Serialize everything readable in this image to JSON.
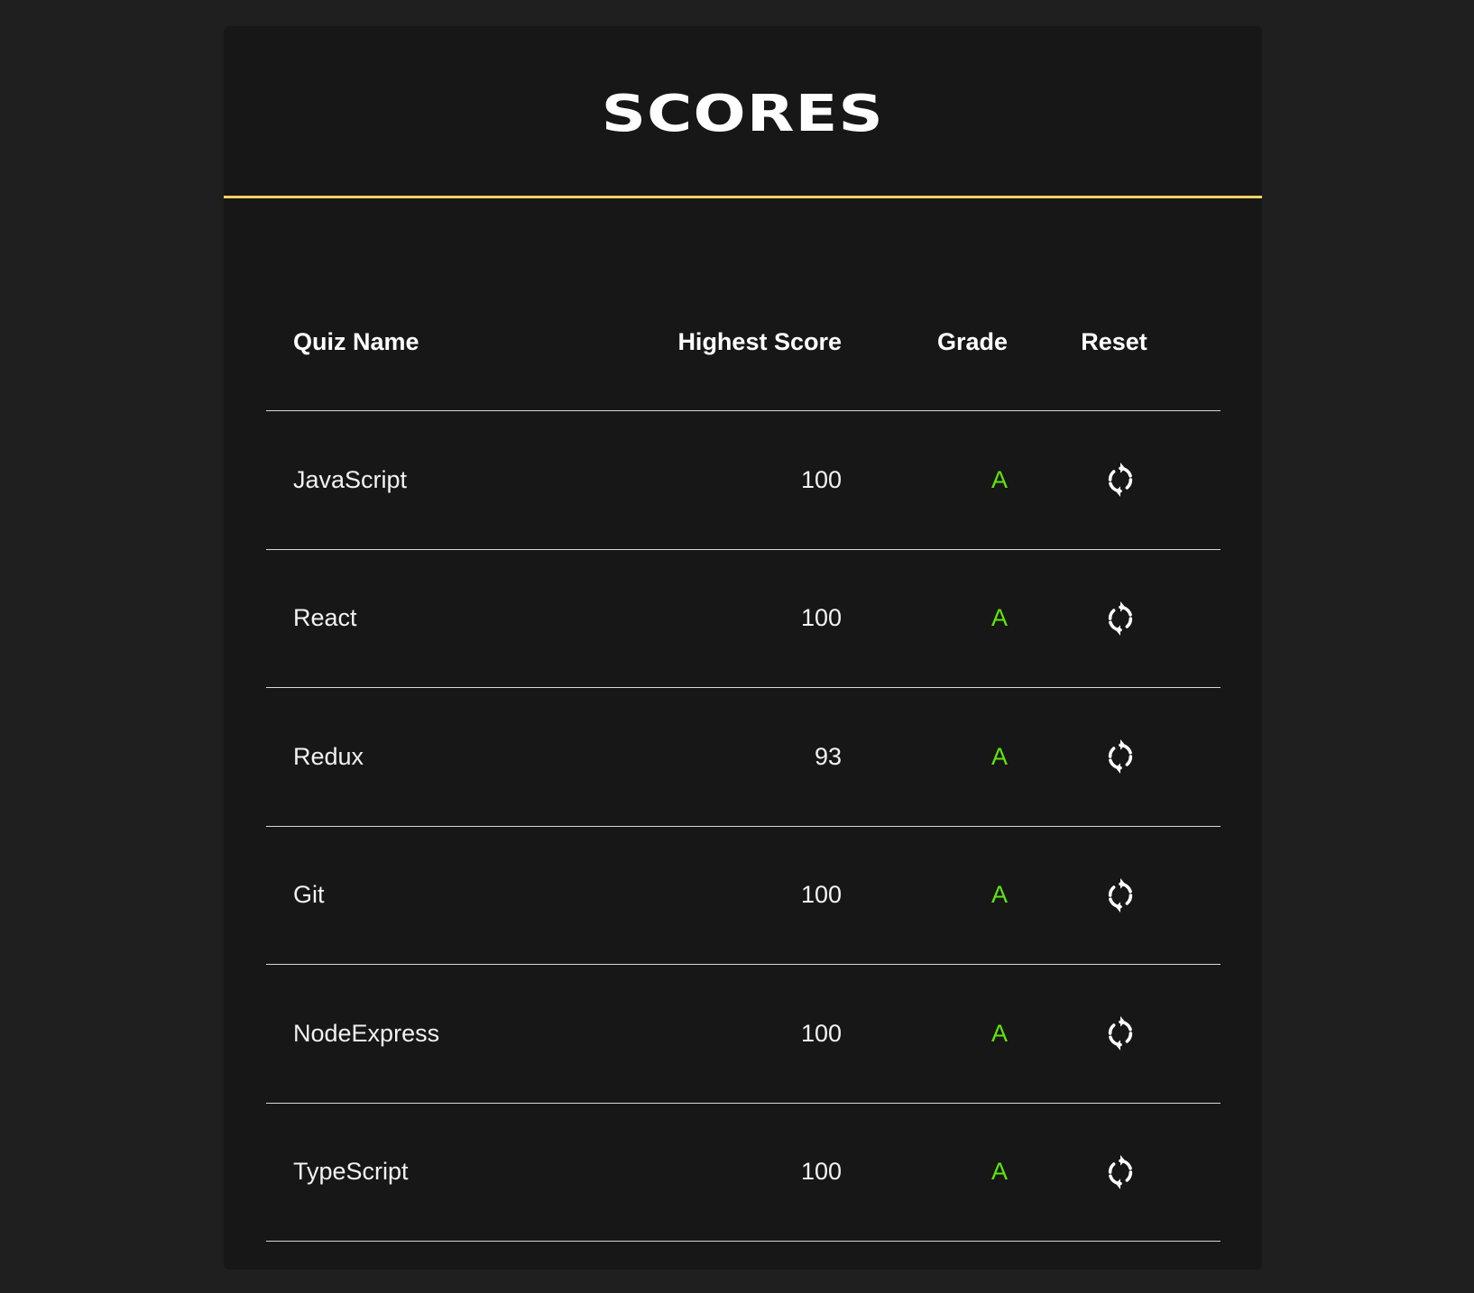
{
  "header": {
    "title": "SCORES"
  },
  "colors": {
    "accent_line": "#f4d35e",
    "grade": "#5fe60a",
    "card_bg": "#171717",
    "page_bg": "#1f1f1f"
  },
  "table": {
    "columns": {
      "quiz_name": "Quiz Name",
      "highest_score": "Highest Score",
      "grade": "Grade",
      "reset": "Reset"
    },
    "rows": [
      {
        "quiz_name": "JavaScript",
        "highest_score": "100",
        "grade": "A",
        "reset_icon": "refresh-icon"
      },
      {
        "quiz_name": "React",
        "highest_score": "100",
        "grade": "A",
        "reset_icon": "refresh-icon"
      },
      {
        "quiz_name": "Redux",
        "highest_score": "93",
        "grade": "A",
        "reset_icon": "refresh-icon"
      },
      {
        "quiz_name": "Git",
        "highest_score": "100",
        "grade": "A",
        "reset_icon": "refresh-icon"
      },
      {
        "quiz_name": "NodeExpress",
        "highest_score": "100",
        "grade": "A",
        "reset_icon": "refresh-icon"
      },
      {
        "quiz_name": "TypeScript",
        "highest_score": "100",
        "grade": "A",
        "reset_icon": "refresh-icon"
      }
    ]
  }
}
